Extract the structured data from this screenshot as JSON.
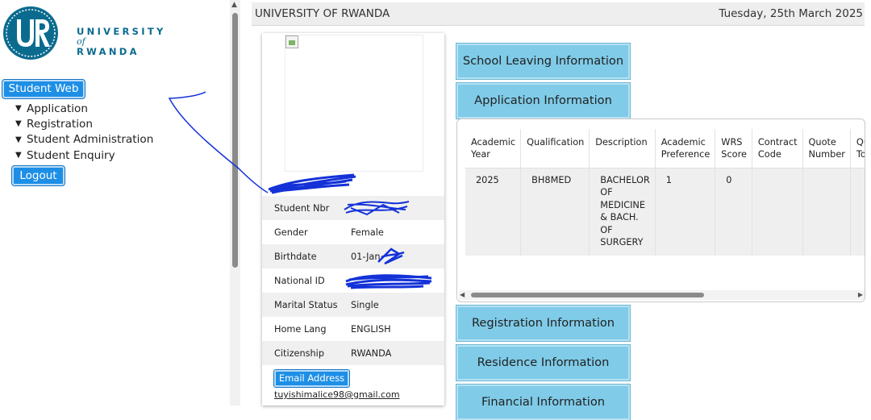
{
  "logo": {
    "line1": "UNIVERSITY",
    "of": "of",
    "line2": "RWANDA"
  },
  "sidebar": {
    "student_web": "Student Web",
    "menu": [
      {
        "label": "Application"
      },
      {
        "label": "Registration"
      },
      {
        "label": "Student Administration"
      },
      {
        "label": "Student Enquiry"
      }
    ],
    "logout": "Logout"
  },
  "header": {
    "title": "UNIVERSITY OF RWANDA",
    "date": "Tuesday, 25th March 2025"
  },
  "profile": {
    "rows": [
      {
        "label": "Student Nbr",
        "value": ""
      },
      {
        "label": "Gender",
        "value": "Female"
      },
      {
        "label": "Birthdate",
        "value": "01-Jan"
      },
      {
        "label": "National ID",
        "value": ""
      },
      {
        "label": "Marital Status",
        "value": "Single"
      },
      {
        "label": "Home Lang",
        "value": "ENGLISH"
      },
      {
        "label": "Citizenship",
        "value": "RWANDA"
      }
    ],
    "email_button": "Email Address",
    "email": "tuyishimalice98@gmail.com"
  },
  "sections": {
    "school_leaving": "School Leaving Information",
    "application": "Application Information",
    "registration": "Registration Information",
    "residence": "Residence Information",
    "financial": "Financial Information"
  },
  "application_table": {
    "headers": [
      "Academic Year",
      "Qualification",
      "Description",
      "Academic Preference",
      "WRS Score",
      "Contract Code",
      "Quote Number",
      "Quote Total"
    ],
    "row": [
      "2025",
      "BH8MED",
      "BACHELOR OF MEDICINE & BACH. OF SURGERY",
      "1",
      "0",
      "",
      "",
      ""
    ]
  },
  "colors": {
    "accent_button": "#1e8fe6",
    "section_button": "#7fcbe8",
    "logo": "#0b6b8f",
    "redaction_ink": "#1432d8"
  }
}
